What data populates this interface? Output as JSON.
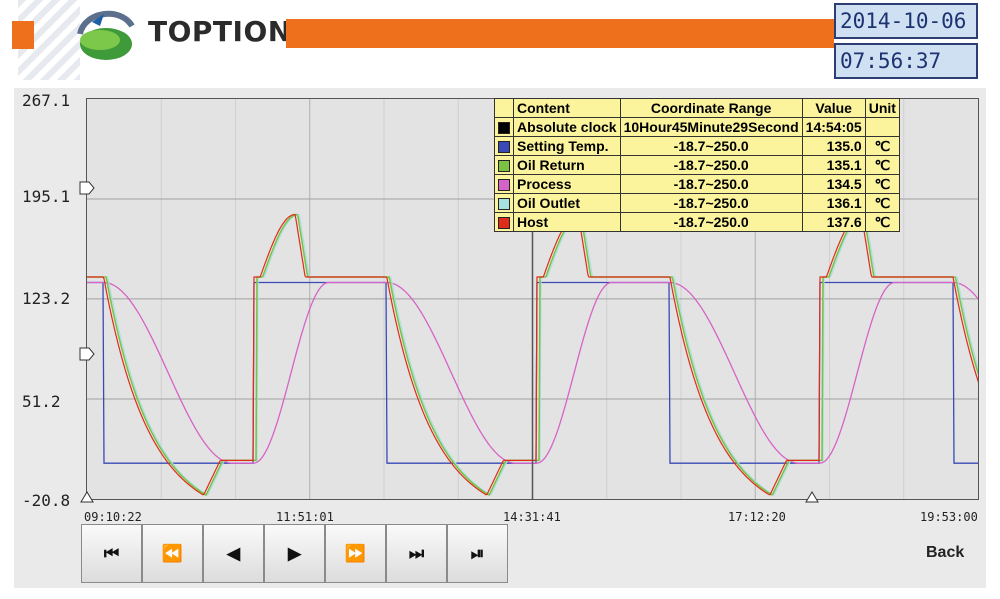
{
  "header": {
    "brand": "TOPTION",
    "date": "2014-10-06",
    "time": "07:56:37",
    "accent_color": "#ee6f1c"
  },
  "chart_data": {
    "type": "line",
    "y_ticks": [
      "267.1",
      "195.1",
      "123.2",
      "51.2",
      "-20.8"
    ],
    "ylim": [
      -20.8,
      267.1
    ],
    "x_ticks": [
      "09:10:22",
      "11:51:01",
      "14:31:41",
      "17:12:20",
      "19:53:00"
    ],
    "grid": true,
    "legend_position": "top-right",
    "legend": {
      "headers": [
        "Content",
        "Coordinate Range",
        "Value",
        "Unit"
      ],
      "rows": [
        {
          "name": "Absolute clock",
          "color": "#000000",
          "range": "10Hour45Minute29Second",
          "value": "14:54:05",
          "unit": ""
        },
        {
          "name": "Setting Temp.",
          "color": "#3a49b8",
          "range": "-18.7~250.0",
          "value": "135.0",
          "unit": "℃"
        },
        {
          "name": "Oil Return",
          "color": "#7bc142",
          "range": "-18.7~250.0",
          "value": "135.1",
          "unit": "℃"
        },
        {
          "name": "Process",
          "color": "#d663c8",
          "range": "-18.7~250.0",
          "value": "134.5",
          "unit": "℃"
        },
        {
          "name": "Oil Outlet",
          "color": "#a8e0e0",
          "range": "-18.7~250.0",
          "value": "136.1",
          "unit": "℃"
        },
        {
          "name": "Host",
          "color": "#e02c1a",
          "range": "-18.7~250.0",
          "value": "137.6",
          "unit": "℃"
        }
      ]
    },
    "x_range_hours": [
      0,
      10.7
    ],
    "period_hours": 3.4,
    "setting_high": 135.0,
    "setting_low": 5.0,
    "peak_value": 184.0,
    "trough_value": -18.0
  },
  "buttons": [
    {
      "name": "first-button",
      "icon": "⏮"
    },
    {
      "name": "fast-rewind-button",
      "icon": "⏪"
    },
    {
      "name": "step-back-button",
      "icon": "◀"
    },
    {
      "name": "step-forward-button",
      "icon": "▶"
    },
    {
      "name": "fast-forward-button",
      "icon": "⏩"
    },
    {
      "name": "last-button",
      "icon": "⏭"
    },
    {
      "name": "stop-button",
      "icon": "⏯"
    }
  ],
  "back_label": "Back"
}
